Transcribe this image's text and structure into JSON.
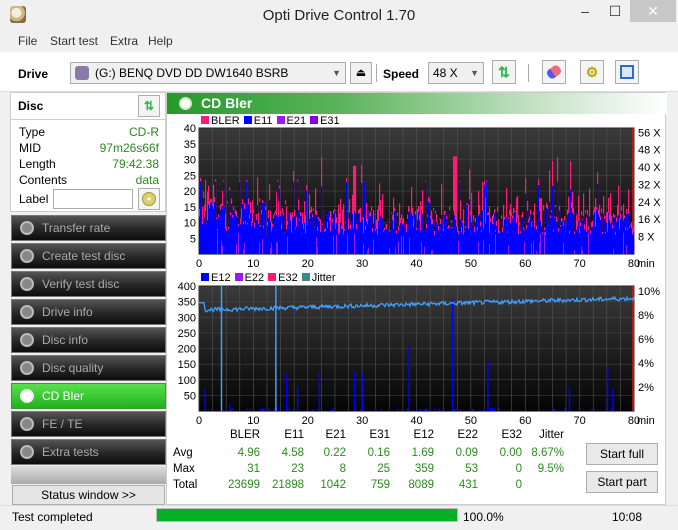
{
  "window": {
    "title": "Opti Drive Control 1.70",
    "minimize": "‒",
    "maximize": "☐",
    "close": "✕"
  },
  "menu": [
    "File",
    "Start test",
    "Extra",
    "Help"
  ],
  "toolbar": {
    "drive_label": "Drive",
    "drive_value": "(G:)  BENQ DVD DD DW1640 BSRB",
    "speed_label": "Speed",
    "speed_value": "48 X"
  },
  "disc": {
    "header": "Disc",
    "type_label": "Type",
    "type_value": "CD-R",
    "mid_label": "MID",
    "mid_value": "97m26s66f",
    "length_label": "Length",
    "length_value": "79:42.38",
    "contents_label": "Contents",
    "contents_value": "data",
    "label_label": "Label",
    "label_value": ""
  },
  "nav": [
    {
      "label": "Transfer rate",
      "active": false
    },
    {
      "label": "Create test disc",
      "active": false
    },
    {
      "label": "Verify test disc",
      "active": false
    },
    {
      "label": "Drive info",
      "active": false
    },
    {
      "label": "Disc info",
      "active": false
    },
    {
      "label": "Disc quality",
      "active": false
    },
    {
      "label": "CD Bler",
      "active": true
    },
    {
      "label": "FE / TE",
      "active": false
    },
    {
      "label": "Extra tests",
      "active": false
    }
  ],
  "status_window_label": "Status window >>",
  "panel_title": "CD Bler",
  "colors": {
    "bler": "#ff1a75",
    "e11": "#0000ff",
    "e21": "#9a1aff",
    "e31": "#8a00e6",
    "e12": "#0000ff",
    "e22": "#9a1aff",
    "e32": "#ff1a75",
    "jitter": "#3a8a8a",
    "jitter_line": "#3ea0ff",
    "accent": "#23b020"
  },
  "chart_data": [
    {
      "type": "bar",
      "title": "CD Bler top",
      "legend": [
        "BLER",
        "E11",
        "E21",
        "E31"
      ],
      "xlabel": "min",
      "x_ticks": [
        "0",
        "10",
        "20",
        "30",
        "40",
        "50",
        "60",
        "70",
        "80"
      ],
      "y_ticks": [
        "5",
        "10",
        "15",
        "20",
        "25",
        "30",
        "35",
        "40"
      ],
      "y_right_ticks": [
        "8 X",
        "16 X",
        "24 X",
        "32 X",
        "40 X",
        "48 X",
        "56 X"
      ],
      "xlim": [
        0,
        80
      ],
      "ylim": [
        0,
        40
      ],
      "series_summary": {
        "bler_typical": 12,
        "bler_peak": 31,
        "e11_typical": 10,
        "e11_peak": 23,
        "peak_x": 47
      },
      "grid": true
    },
    {
      "type": "bar",
      "title": "CD Bler bottom",
      "legend": [
        "E12",
        "E22",
        "E32",
        "Jitter"
      ],
      "xlabel": "min",
      "x_ticks": [
        "0",
        "10",
        "20",
        "30",
        "40",
        "50",
        "60",
        "70",
        "80"
      ],
      "y_ticks": [
        "50",
        "100",
        "150",
        "200",
        "250",
        "300",
        "350",
        "400"
      ],
      "y_right_ticks": [
        "2%",
        "4%",
        "6%",
        "8%",
        "10%"
      ],
      "xlim": [
        0,
        80
      ],
      "ylim": [
        0,
        400
      ],
      "e12_spikes": [
        [
          1,
          70
        ],
        [
          4,
          400
        ],
        [
          5.5,
          25
        ],
        [
          14,
          400
        ],
        [
          16,
          120
        ],
        [
          18,
          80
        ],
        [
          22,
          125
        ],
        [
          28.5,
          125
        ],
        [
          30,
          120
        ],
        [
          38.5,
          210
        ],
        [
          46.5,
          359
        ],
        [
          53,
          160
        ],
        [
          68,
          80
        ],
        [
          75,
          140
        ],
        [
          76,
          70
        ]
      ],
      "jitter_range_pct": [
        8.2,
        9.5
      ],
      "grid": true
    }
  ],
  "stats": {
    "columns": [
      "BLER",
      "E11",
      "E21",
      "E31",
      "E12",
      "E22",
      "E32",
      "Jitter"
    ],
    "rows": [
      {
        "label": "Avg",
        "values": [
          "4.96",
          "4.58",
          "0.22",
          "0.16",
          "1.69",
          "0.09",
          "0.00",
          "8.67%"
        ]
      },
      {
        "label": "Max",
        "values": [
          "31",
          "23",
          "8",
          "25",
          "359",
          "53",
          "0",
          "9.5%"
        ]
      },
      {
        "label": "Total",
        "values": [
          "23699",
          "21898",
          "1042",
          "759",
          "8089",
          "431",
          "0",
          ""
        ]
      }
    ]
  },
  "buttons": {
    "start_full": "Start full",
    "start_part": "Start part"
  },
  "statusbar": {
    "text": "Test completed",
    "progress_pct": 100,
    "progress_label": "100.0%",
    "time": "10:08"
  }
}
